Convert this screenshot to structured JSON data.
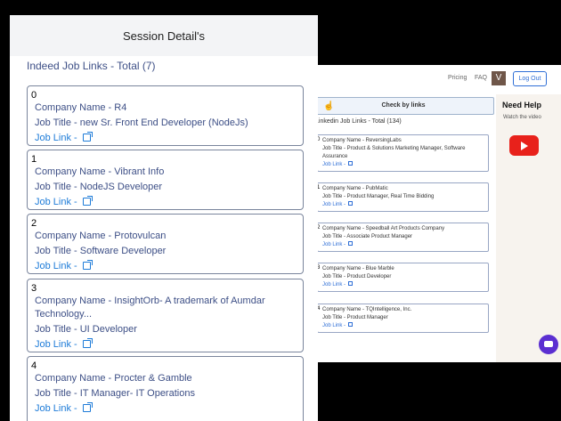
{
  "back": {
    "nav": {
      "pricing": "Pricing",
      "faq": "FAQ",
      "avatar": "V",
      "logout": "Log Out"
    },
    "check_button": "Check by links",
    "list_title": "Linkedin Job Links - Total (134)",
    "items": [
      {
        "index": "0",
        "company": "Company Name - ReversingLabs",
        "title": "Job Title - Product & Solutions Marketing Manager, Software Assurance",
        "link": "Job Link -"
      },
      {
        "index": "1",
        "company": "Company Name - PubMatic",
        "title": "Job Title - Product Manager, Real Time Bidding",
        "link": "Job Link -"
      },
      {
        "index": "2",
        "company": "Company Name - Speedball Art Products Company",
        "title": "Job Title - Associate Product Manager",
        "link": "Job Link -"
      },
      {
        "index": "3",
        "company": "Company Name - Blue Marble",
        "title": "Job Title - Product Developer",
        "link": "Job Link -"
      },
      {
        "index": "4",
        "company": "Company Name - TQIntelligence, Inc.",
        "title": "Job Title - Product Manager",
        "link": "Job Link -"
      }
    ],
    "help": {
      "title": "Need Help",
      "subtitle": "Watch the video"
    }
  },
  "front": {
    "header": "Session Detail's",
    "list_title": "Indeed Job Links - Total (7)",
    "items": [
      {
        "index": "0",
        "company": "Company Name - R4",
        "title": "Job Title - new Sr. Front End Developer (NodeJs)",
        "link": "Job Link -"
      },
      {
        "index": "1",
        "company": "Company Name - Vibrant Info",
        "title": "Job Title - NodeJS Developer",
        "link": "Job Link -"
      },
      {
        "index": "2",
        "company": "Company Name - Protovulcan",
        "title": "Job Title - Software Developer",
        "link": "Job Link -"
      },
      {
        "index": "3",
        "company": "Company Name - InsightOrb- A trademark of Aumdar Technology...",
        "title": "Job Title - UI Developer",
        "link": "Job Link -"
      },
      {
        "index": "4",
        "company": "Company Name - Procter & Gamble",
        "title": "Job Title - IT Manager- IT Operations",
        "link": "Job Link -"
      }
    ]
  }
}
